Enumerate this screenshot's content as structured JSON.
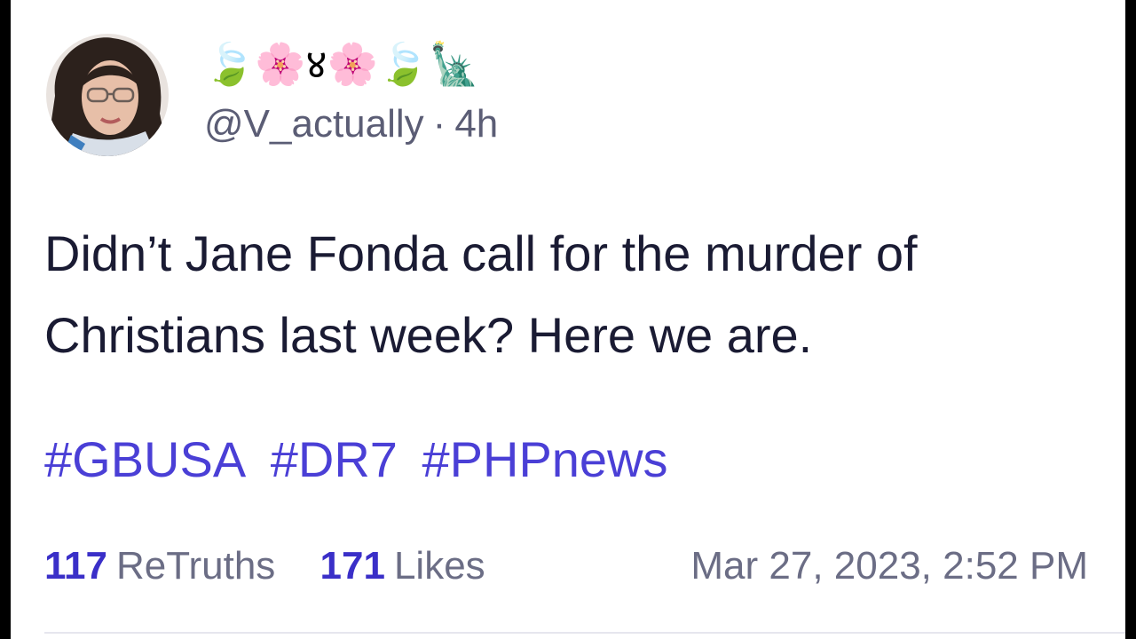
{
  "post": {
    "display_name": "🍃🌸४🌸🍃🗽",
    "handle": "@V_actually",
    "separator": "·",
    "relative_time": "4h",
    "text": "Didn’t Jane Fonda call for the murder of Christians last week? Here we are.",
    "hashtags": [
      "#GBUSA",
      "#DR7",
      "#PHPnews"
    ],
    "stats": {
      "retruths_count": "117",
      "retruths_label": "ReTruths",
      "likes_count": "171",
      "likes_label": "Likes"
    },
    "timestamp": "Mar 27, 2023, 2:52 PM"
  },
  "colors": {
    "hashtag": "#4a3fd6",
    "stat_number": "#3a2fc8",
    "body_text": "#1a1b33",
    "muted_text": "#5b5d75"
  }
}
